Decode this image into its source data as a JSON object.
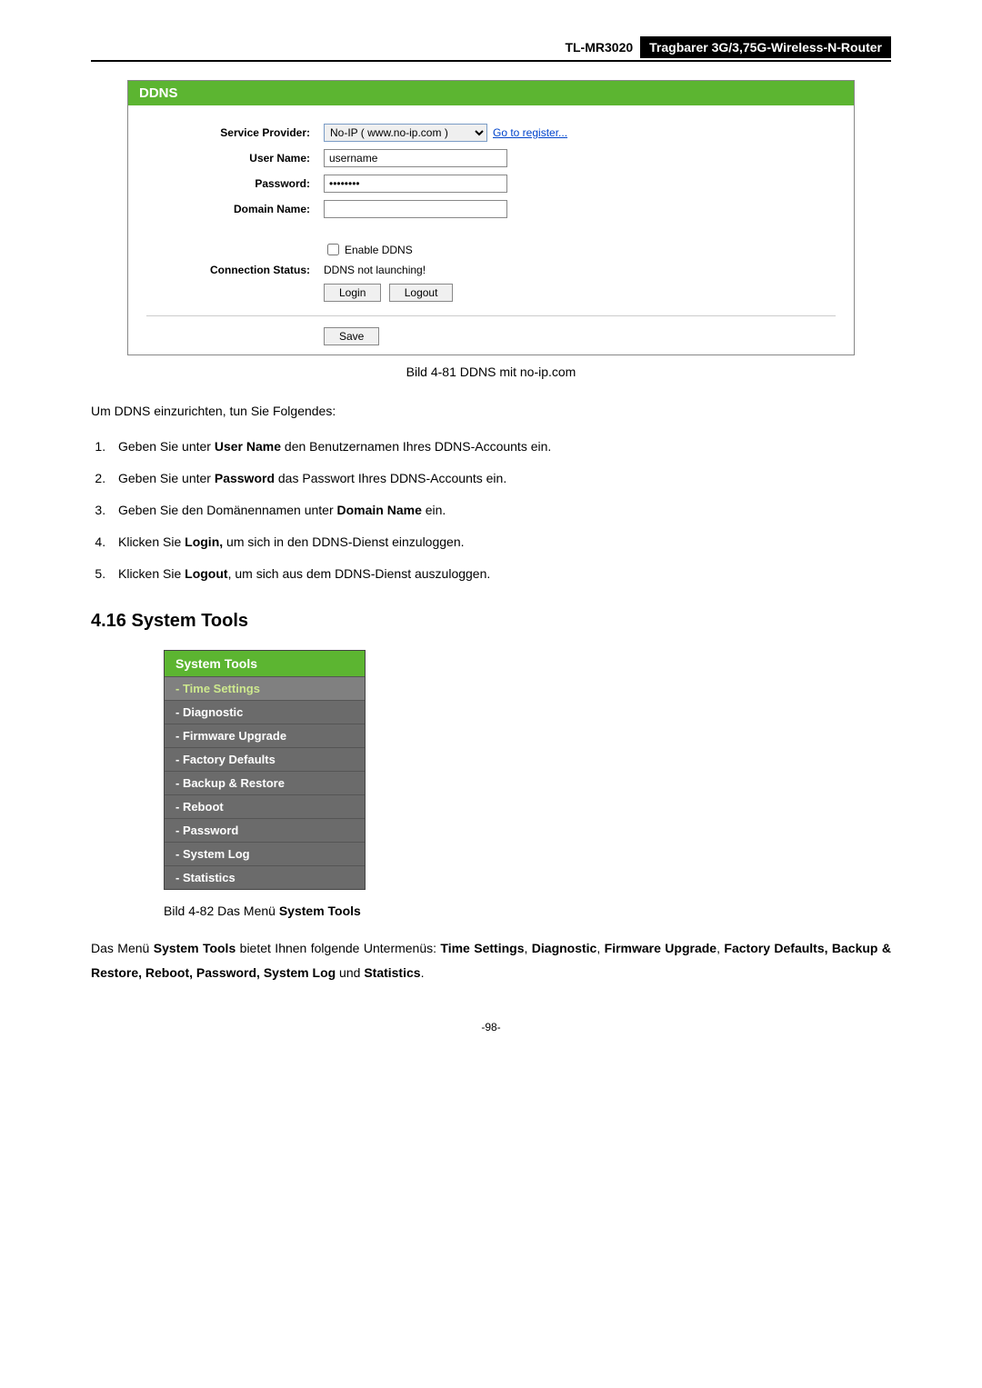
{
  "header": {
    "model": "TL-MR3020",
    "desc": "Tragbarer 3G/3,75G-Wireless-N-Router"
  },
  "ddns": {
    "title": "DDNS",
    "labels": {
      "service_provider": "Service Provider:",
      "user_name": "User Name:",
      "password": "Password:",
      "domain_name": "Domain Name:",
      "connection_status": "Connection Status:"
    },
    "service_provider_value": "No-IP ( www.no-ip.com )",
    "go_register": "Go to register...",
    "user_name_value": "username",
    "password_value": "••••••••",
    "domain_name_value": "",
    "enable_ddns_label": "Enable DDNS",
    "connection_status_value": "DDNS not launching!",
    "login_btn": "Login",
    "logout_btn": "Logout",
    "save_btn": "Save"
  },
  "caption1": "Bild 4-81 DDNS mit no-ip.com",
  "intro": "Um DDNS einzurichten, tun Sie Folgendes:",
  "steps": {
    "s1a": "Geben Sie unter ",
    "s1b": "User Name",
    "s1c": " den Benutzernamen Ihres DDNS-Accounts ein.",
    "s2a": "Geben Sie unter ",
    "s2b": "Password",
    "s2c": " das Passwort Ihres DDNS-Accounts ein.",
    "s3a": "Geben Sie den Domänennamen unter ",
    "s3b": "Domain Name",
    "s3c": " ein.",
    "s4a": "Klicken Sie ",
    "s4b": "Login,",
    "s4c": " um sich in den DDNS-Dienst einzuloggen.",
    "s5a": "Klicken Sie ",
    "s5b": "Logout",
    "s5c": ", um sich aus dem DDNS-Dienst auszuloggen."
  },
  "section_heading": "4.16  System Tools",
  "menu": {
    "header": "System Tools",
    "items": [
      "- Time Settings",
      "- Diagnostic",
      "- Firmware Upgrade",
      "- Factory Defaults",
      "- Backup & Restore",
      "- Reboot",
      "- Password",
      "- System Log",
      "- Statistics"
    ]
  },
  "caption2a": "Bild 4-82 Das Menü ",
  "caption2b": "System Tools",
  "para2": {
    "a": "Das Menü ",
    "b": "System Tools",
    "c": " bietet Ihnen folgende Untermenüs: ",
    "d": "Time Settings",
    "e": ", ",
    "f": "Diagnostic",
    "g": ", ",
    "h": "Firmware Upgrade",
    "i": ", ",
    "j": "Factory Defaults, Backup & Restore, Reboot, Password, System Log",
    "k": " und ",
    "l": "Statistics",
    "m": "."
  },
  "page_num": "-98-"
}
